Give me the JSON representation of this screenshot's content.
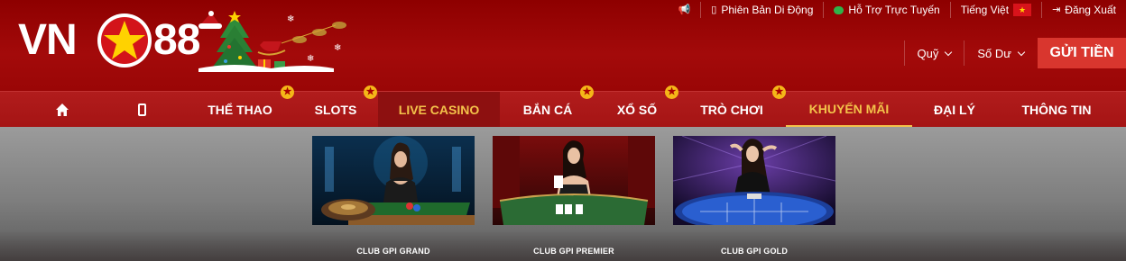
{
  "brand": {
    "left": "VN",
    "right": "88"
  },
  "topbar": {
    "mobile_label": "Phiên Bản Di Động",
    "support_label": "Hỗ Trợ Trực Tuyến",
    "language_label": "Tiếng Việt",
    "logout_label": "Đăng Xuất"
  },
  "account": {
    "fund_label": "Quỹ",
    "balance_label": "Số Dư",
    "deposit_label": "GỬI TIỀN"
  },
  "nav": {
    "items": [
      {
        "label": "THỂ THAO"
      },
      {
        "label": "SLOTS"
      },
      {
        "label": "LIVE CASINO"
      },
      {
        "label": "BẮN CÁ"
      },
      {
        "label": "XỔ SỐ"
      },
      {
        "label": "TRÒ CHƠI"
      },
      {
        "label": "KHUYẾN MÃI"
      },
      {
        "label": "ĐẠI LÝ"
      },
      {
        "label": "THÔNG TIN"
      }
    ]
  },
  "games": [
    {
      "label": "CLUB GPI GRAND"
    },
    {
      "label": "CLUB GPI PREMIER"
    },
    {
      "label": "CLUB GPI GOLD"
    }
  ],
  "colors": {
    "header_red": "#9a0606",
    "nav_red": "#ab1818",
    "accent_gold": "#f3c24a",
    "deposit_red": "#d9362e"
  }
}
